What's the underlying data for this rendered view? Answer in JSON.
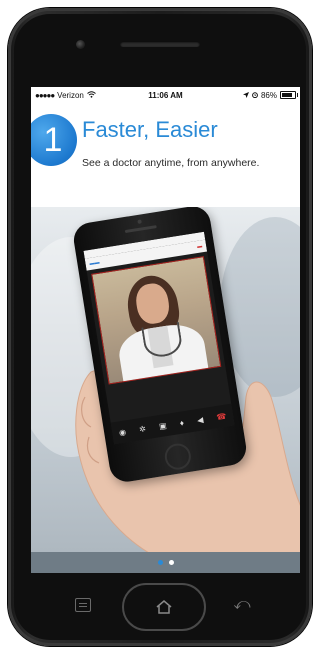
{
  "status_bar": {
    "signal_dots": "●●●●●",
    "carrier": "Verizon",
    "wifi_icon": "wifi-icon",
    "time": "11:06 AM",
    "location_icon": "location-arrow-icon",
    "alarm_icon": "alarm-icon",
    "battery_percent": "86%",
    "battery_level": 0.86
  },
  "onboarding": {
    "step_number": "1",
    "title": "Faster, Easier",
    "subtitle": "See a doctor anytime, from anywhere."
  },
  "pagination": {
    "total": 2,
    "active_index": 0
  },
  "colors": {
    "accent": "#2a8ad6",
    "end_call": "#e23b3b",
    "video_frame": "#a9231f"
  },
  "device_nav": {
    "recent_icon": "recent-apps-icon",
    "home_icon": "home-icon",
    "back_icon": "back-icon"
  }
}
